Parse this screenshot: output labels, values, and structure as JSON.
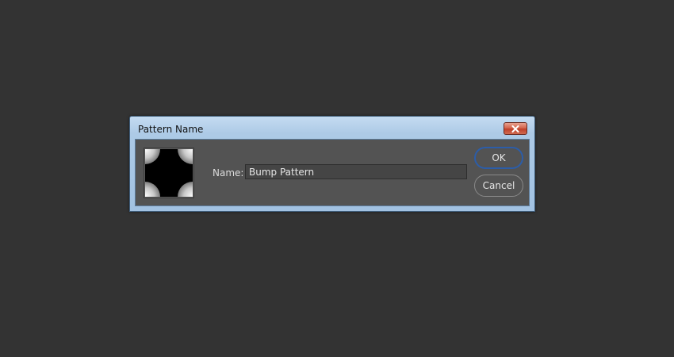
{
  "dialog": {
    "title": "Pattern Name",
    "name_label": "Name:",
    "name_value": "Bump Pattern",
    "ok_label": "OK",
    "cancel_label": "Cancel"
  },
  "icons": {
    "close": "close-icon",
    "preview": "pattern-preview"
  }
}
